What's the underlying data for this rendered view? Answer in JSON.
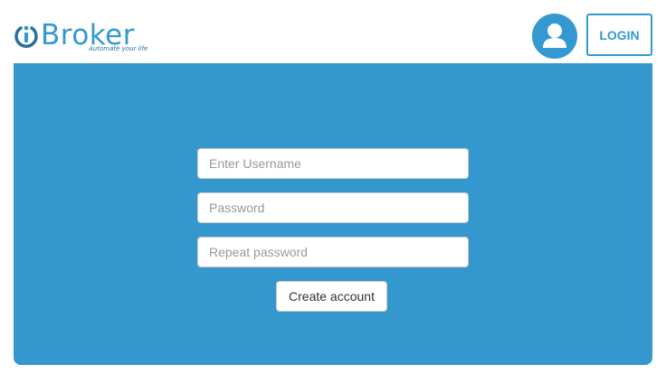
{
  "header": {
    "logo": {
      "text": "Broker",
      "tagline": "Automate your life",
      "icon": "ibroker-power-icon"
    },
    "avatar_icon": "user-icon",
    "login_label": "LOGIN"
  },
  "form": {
    "username_placeholder": "Enter Username",
    "password_placeholder": "Password",
    "repeat_password_placeholder": "Repeat password",
    "create_account_label": "Create account"
  },
  "colors": {
    "accent": "#3498d1",
    "panel": "#3498ce",
    "background": "#ffffff"
  }
}
